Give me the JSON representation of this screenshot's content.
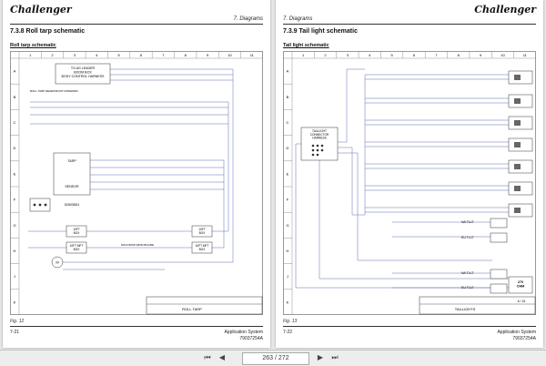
{
  "brand": "Challenger",
  "left_page": {
    "section": "7. Diagrams",
    "title": "7.3.8  Roll tarp schematic",
    "subtitle": "Roll tarp schematic",
    "columns": [
      "1",
      "2",
      "3",
      "4",
      "5",
      "6",
      "7",
      "8",
      "9",
      "10",
      "11"
    ],
    "rows": [
      "A",
      "B",
      "C",
      "D",
      "E",
      "F",
      "G",
      "H",
      "J",
      "K"
    ],
    "labels": {
      "leader": "TO AG LEADER\nBOOM BOX\nBODY CONTROL HARNESS",
      "tarp_top": "ROLL TARP REAR/FRONT FORWARD",
      "tarp_box_top": "TARP",
      "tarp_box_bot": "SENSOR",
      "ids": "525036D1",
      "box1": "10FT\nBOX",
      "box2": "10FT\nBOX",
      "box3": "10FT MFT\nBOX",
      "box4": "10FT MFT\nBOX",
      "center": "SOCODISS WIND BOARD",
      "roll": "ROLL TARP"
    },
    "figure": "Fig. 12",
    "footer_title": "Application System",
    "footer_code": "79037254A",
    "page": "7-21"
  },
  "right_page": {
    "section": "7. Diagrams",
    "title": "7.3.9  Tail light schematic",
    "subtitle": "Tail light schematic",
    "labels": {
      "conn": "TAILLIGHT\nCONNECTOR\nHARNESS",
      "ltm1": "NA TLLT",
      "ltm2": "EU TLLT",
      "ltm3": "NA TLLT",
      "ltm4": "EU TLLT",
      "chm": "270\nCHM",
      "taillights": "TAILLIGHTS",
      "page_ref": "6 / 15"
    },
    "figure": "Fig. 13",
    "footer_title": "Application System",
    "footer_code": "79037254A",
    "page": "7-22"
  },
  "toolbar": {
    "page_indicator": "263 / 272"
  }
}
